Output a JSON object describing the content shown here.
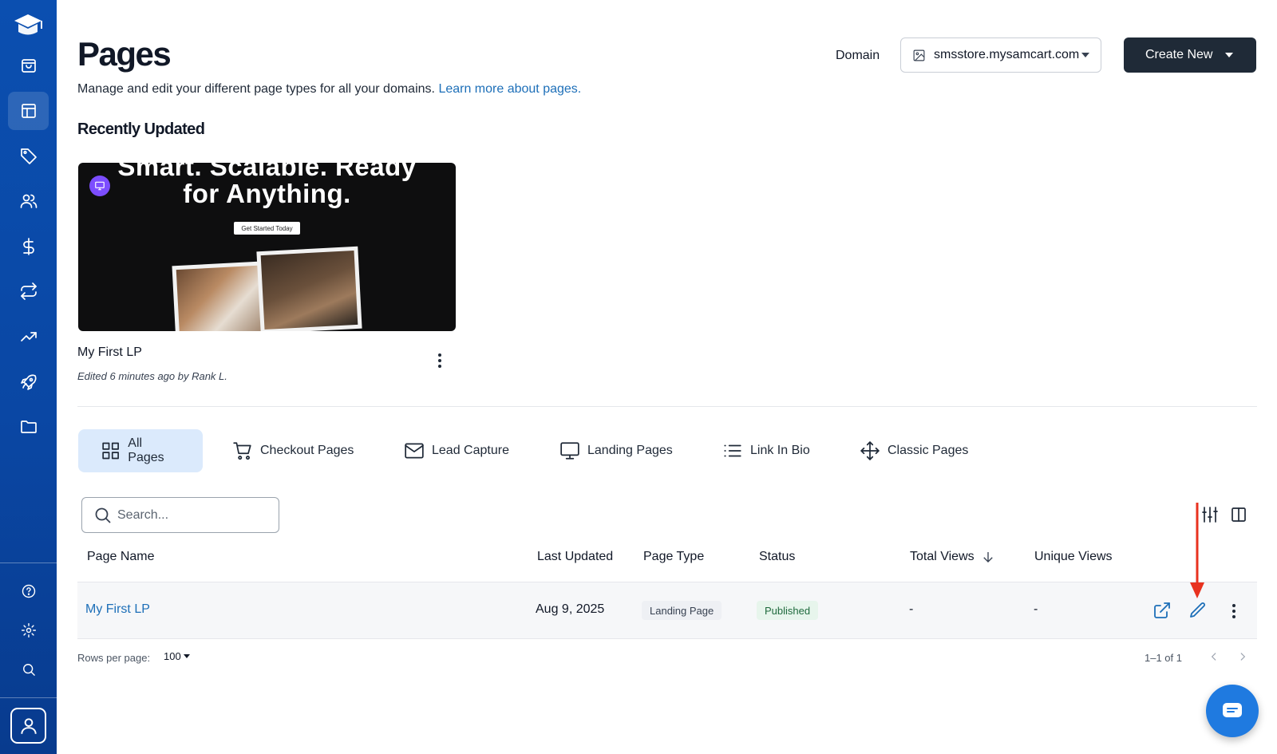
{
  "header": {
    "title": "Pages",
    "subtitle": "Manage and edit your different page types for all your domains.",
    "learn_more": "Learn more about pages.",
    "domain_label": "Domain",
    "domain_value": "smsstore.mysamcart.com",
    "create_label": "Create New"
  },
  "sidebar": {
    "top_items": [
      {
        "icon": "bag-icon"
      },
      {
        "icon": "layout-icon",
        "active": true
      },
      {
        "icon": "tag-icon"
      },
      {
        "icon": "users-icon"
      },
      {
        "icon": "dollar-icon"
      },
      {
        "icon": "repeat-icon"
      },
      {
        "icon": "trending-up-icon"
      },
      {
        "icon": "rocket-icon"
      },
      {
        "icon": "folder-icon"
      }
    ],
    "bottom_items": [
      {
        "icon": "help-icon"
      },
      {
        "icon": "gear-icon"
      },
      {
        "icon": "search-icon"
      }
    ]
  },
  "recent": {
    "section_title": "Recently Updated",
    "card": {
      "thumb_line1": "Smart. Scalable. Ready",
      "thumb_line2": "for Anything.",
      "thumb_cta": "Get Started Today",
      "name": "My First LP",
      "meta": "Edited 6 minutes ago by Rank L."
    }
  },
  "tabs": [
    {
      "label": "All Pages",
      "icon": "grid-icon",
      "active": true
    },
    {
      "label": "Checkout Pages",
      "icon": "cart-icon"
    },
    {
      "label": "Lead Capture",
      "icon": "mail-icon"
    },
    {
      "label": "Landing Pages",
      "icon": "monitor-icon"
    },
    {
      "label": "Link In Bio",
      "icon": "list-icon"
    },
    {
      "label": "Classic Pages",
      "icon": "move-icon"
    }
  ],
  "search": {
    "placeholder": "Search..."
  },
  "table": {
    "columns": [
      "Page Name",
      "Last Updated",
      "Page Type",
      "Status",
      "Total Views",
      "Unique Views"
    ],
    "rows": [
      {
        "name": "My First LP",
        "updated": "Aug 9, 2025",
        "type": "Landing Page",
        "status": "Published",
        "total_views": "-",
        "unique_views": "-"
      }
    ]
  },
  "pagination": {
    "rows_per_page_label": "Rows per page:",
    "rows_per_page": "100",
    "range": "1–1 of 1"
  },
  "colors": {
    "sidebar": "#0b4fb0",
    "primary_button": "#1f2a37",
    "link": "#1d6fb8",
    "active_tab": "#dbeafc",
    "annotation_arrow": "#e8321f",
    "chat": "#1f7ae0"
  }
}
